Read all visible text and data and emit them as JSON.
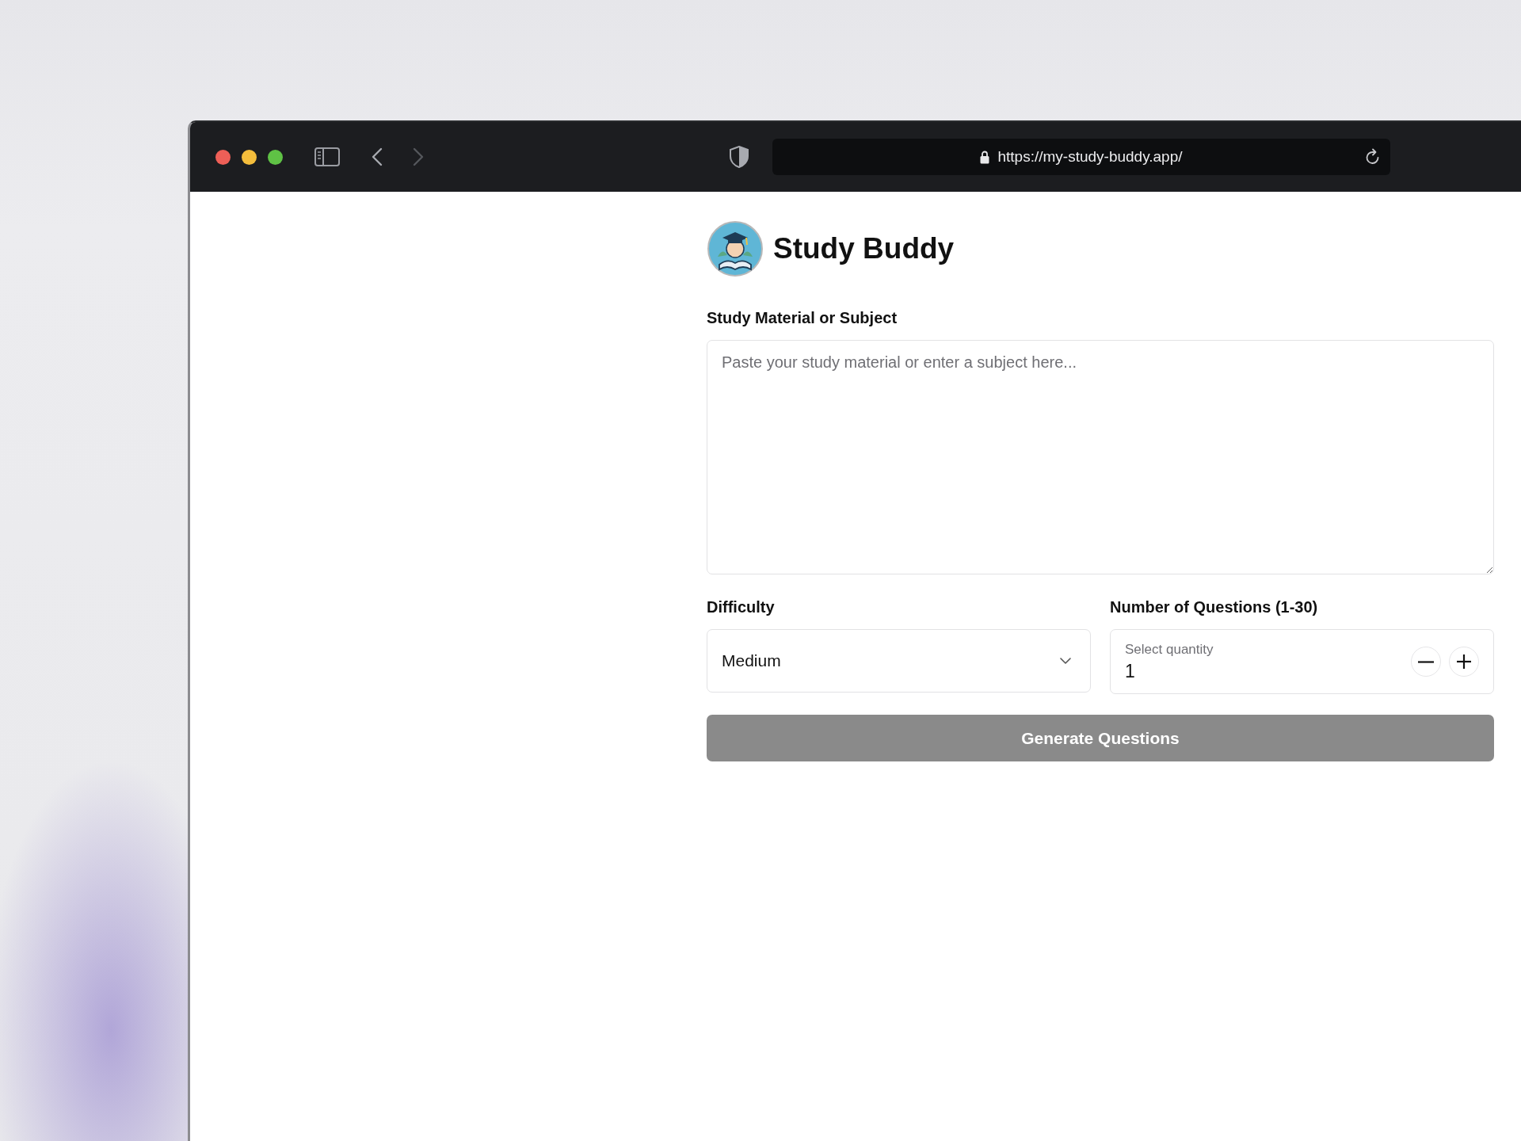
{
  "browser": {
    "url": "https://my-study-buddy.app/"
  },
  "app": {
    "title": "Study Buddy"
  },
  "material": {
    "label": "Study Material or Subject",
    "placeholder": "Paste your study material or enter a subject here..."
  },
  "difficulty": {
    "label": "Difficulty",
    "value": "Medium"
  },
  "quantity": {
    "label": "Number of Questions (1-30)",
    "placeholder": "Select quantity",
    "value": "1"
  },
  "submit": {
    "label": "Generate Questions",
    "disabled": true
  }
}
